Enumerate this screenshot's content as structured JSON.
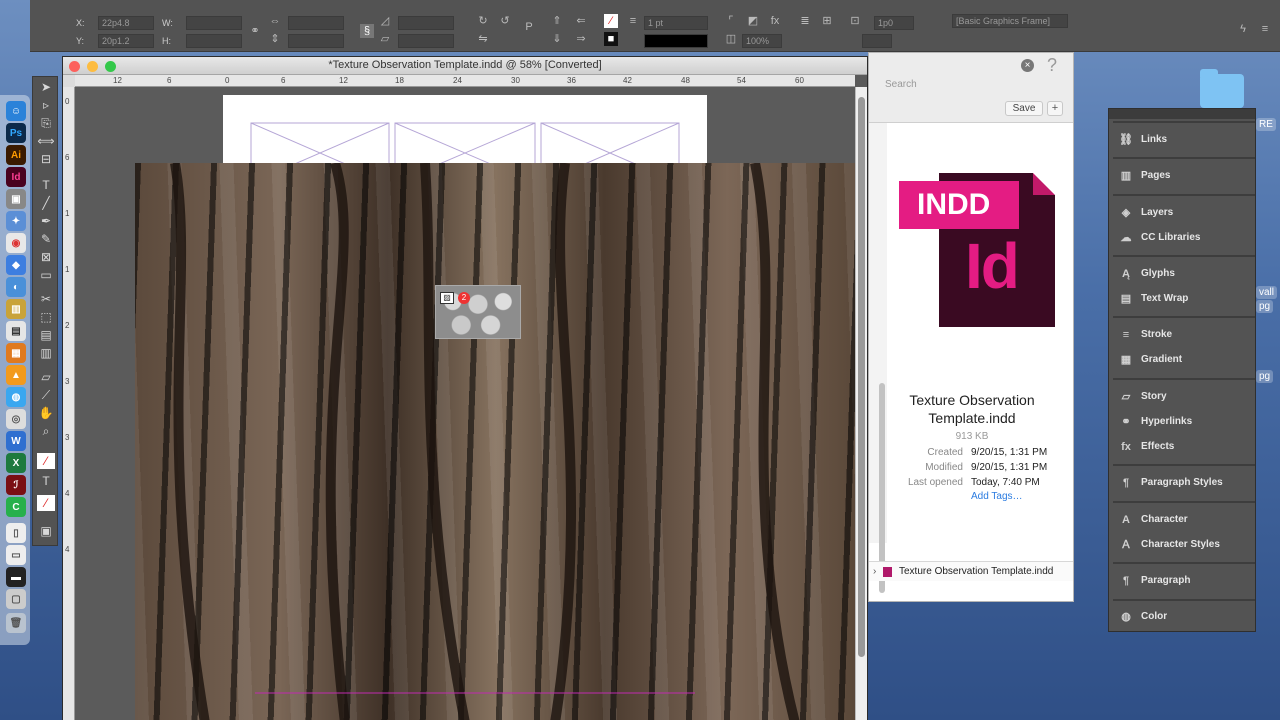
{
  "control_bar": {
    "x_label": "X:",
    "y_label": "Y:",
    "x_value": "22p4.8",
    "y_value": "20p1.2",
    "w_label": "W:",
    "h_label": "H:",
    "stroke_weight": "1 pt",
    "zoom_field": "100%",
    "spacing_value": "1p0",
    "object_style": "[Basic Graphics Frame]"
  },
  "document": {
    "title": "*Texture Observation Template.indd @ 58% [Converted]",
    "ruler_h_ticks": [
      "12",
      "6",
      "0",
      "6",
      "12",
      "18",
      "24",
      "30",
      "36",
      "42",
      "48",
      "54",
      "60"
    ],
    "ruler_v_ticks": [
      "0",
      "6",
      "1",
      "1",
      "2",
      "3",
      "3",
      "4",
      "4"
    ],
    "place_count": "2"
  },
  "finder": {
    "search_placeholder": "Search",
    "save_label": "Save",
    "add_label": "+",
    "close_label": "×",
    "help_label": "?",
    "icon_banner": "INDD",
    "icon_letters": "Id",
    "file_name": "Texture Observation Template.indd",
    "file_size": "913 KB",
    "created_label": "Created",
    "created_value": "9/20/15, 1:31 PM",
    "modified_label": "Modified",
    "modified_value": "9/20/15, 1:31 PM",
    "opened_label": "Last opened",
    "opened_value": "Today, 7:40 PM",
    "add_tags": "Add Tags…",
    "path_item": "Texture Observation Template.indd"
  },
  "desktop": {
    "label_right_1": "RE",
    "label_right_2": "vall",
    "label_right_3": "pg",
    "label_right_4": "pg"
  },
  "panels": {
    "items": [
      {
        "label": "Links",
        "icon": "link-icon"
      },
      {
        "label": "Pages",
        "icon": "pages-icon"
      },
      {
        "label": "Layers",
        "icon": "layers-icon"
      },
      {
        "label": "CC Libraries",
        "icon": "cc-libraries-icon"
      },
      {
        "label": "Glyphs",
        "icon": "glyphs-icon"
      },
      {
        "label": "Text Wrap",
        "icon": "text-wrap-icon"
      },
      {
        "label": "Stroke",
        "icon": "stroke-icon"
      },
      {
        "label": "Gradient",
        "icon": "gradient-icon"
      },
      {
        "label": "Story",
        "icon": "story-icon"
      },
      {
        "label": "Hyperlinks",
        "icon": "hyperlinks-icon"
      },
      {
        "label": "Effects",
        "icon": "effects-icon"
      },
      {
        "label": "Paragraph Styles",
        "icon": "paragraph-styles-icon"
      },
      {
        "label": "Character",
        "icon": "character-icon"
      },
      {
        "label": "Character Styles",
        "icon": "character-styles-icon"
      },
      {
        "label": "Paragraph",
        "icon": "paragraph-icon"
      },
      {
        "label": "Color",
        "icon": "color-icon"
      }
    ]
  },
  "colors": {
    "indesign_pink": "#e41c83",
    "indesign_dark": "#3a0a22",
    "panel_bg": "#535353",
    "link_blue": "#2a7be0"
  }
}
